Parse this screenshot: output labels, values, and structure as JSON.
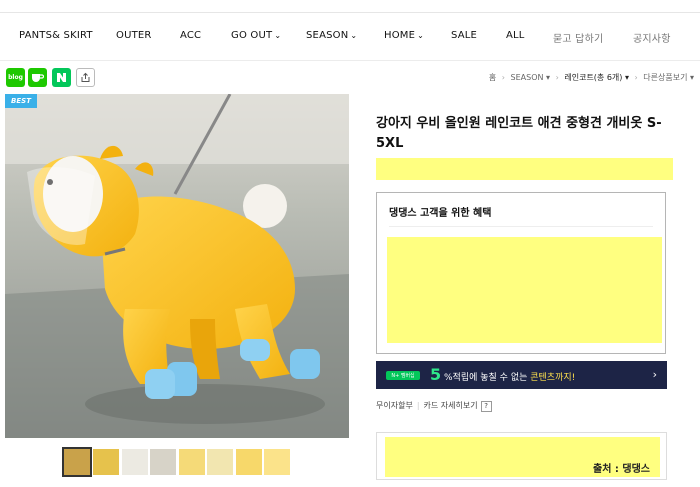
{
  "nav": {
    "items": [
      {
        "label": "PANTS& SKIRT",
        "caret": ""
      },
      {
        "label": "OUTER",
        "caret": ""
      },
      {
        "label": "ACC",
        "caret": ""
      },
      {
        "label": "GO OUT",
        "caret": "⌄"
      },
      {
        "label": "SEASON",
        "caret": "⌄"
      },
      {
        "label": "HOME",
        "caret": "⌄"
      },
      {
        "label": "SALE",
        "caret": ""
      },
      {
        "label": "ALL",
        "caret": ""
      },
      {
        "label": "묻고 답하기",
        "caret": ""
      },
      {
        "label": "공지사항",
        "caret": ""
      }
    ]
  },
  "share": {
    "blog_label": "blog",
    "icons": [
      "naver-blog-icon",
      "naver-cafe-icon",
      "naver-icon",
      "share-link-icon"
    ]
  },
  "breadcrumb": {
    "home": "홈",
    "category": "SEASON",
    "current": "레인코트(총 6개)",
    "other": "다른상품보기"
  },
  "product": {
    "badge": "BEST",
    "title": "강아지 우비 올인원 레인코트 애견 중형견 개비옷 S-5XL",
    "thumbnail_count": 8
  },
  "benefit": {
    "title": "댕댕스 고객을 위한 혜택"
  },
  "promo": {
    "logo": "N+ 멤버십",
    "percent": "5",
    "text_before": "%적립에 놓칠 수 없는 ",
    "text_highlight": "콘텐츠까지!",
    "arrow": "›"
  },
  "card": {
    "installment": "무이자할부",
    "details": "카드 자세히보기",
    "help": "?"
  },
  "source": {
    "text": "출처 : 댕댕스"
  },
  "colors": {
    "highlight_yellow": "#ffff80",
    "promo_bg": "#1d2446",
    "promo_green": "#2ee78a",
    "badge_blue": "#3ab0e8",
    "naver_green": "#03c75a"
  }
}
